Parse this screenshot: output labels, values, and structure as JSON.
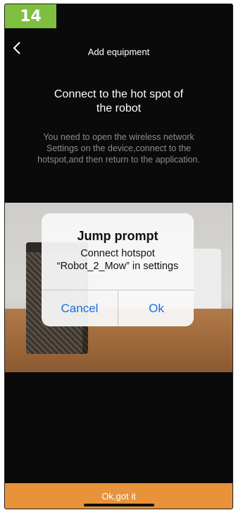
{
  "badge": {
    "number": "14"
  },
  "nav": {
    "title": "Add equipment",
    "back_icon": "chevron-left-icon"
  },
  "content": {
    "heading_line1": "Connect to the hot spot of",
    "heading_line2": "the robot",
    "desc_line1": "You need to open the wireless network",
    "desc_line2": "Settings on the device,connect to the",
    "desc_line3": "hotspot,and then return to the application."
  },
  "dialog": {
    "title": "Jump prompt",
    "message_line1": "Connect hotspot",
    "message_line2": "“Robot_2_Mow” in settings",
    "cancel_label": "Cancel",
    "ok_label": "Ok"
  },
  "footer": {
    "button_label": "Ok,got it"
  },
  "colors": {
    "badge": "#7fbf3f",
    "background": "#0a0a0a",
    "footer": "#e8923a",
    "dialog_button": "#1a6fe0"
  }
}
